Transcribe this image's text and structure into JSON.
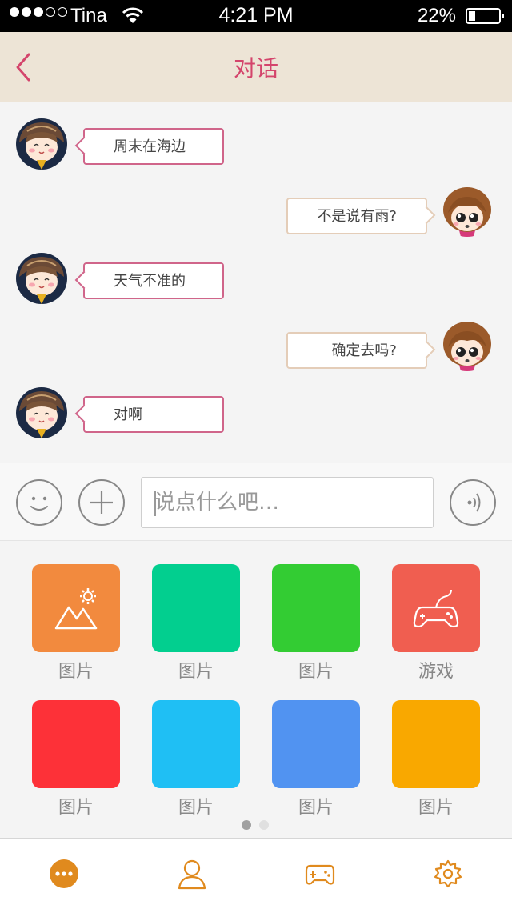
{
  "status": {
    "carrier": "Tina",
    "time": "4:21 PM",
    "battery": "22%",
    "battery_level": 0.22,
    "signal_bars": 3,
    "signal_total": 5
  },
  "nav": {
    "title": "对话",
    "back_icon": "chevron-left-icon"
  },
  "messages": [
    {
      "from": "friend",
      "text": "周末在海边"
    },
    {
      "from": "me",
      "text": "不是说有雨?"
    },
    {
      "from": "friend",
      "text": "天气不准的"
    },
    {
      "from": "me",
      "text": "确定去吗?"
    },
    {
      "from": "friend",
      "text": "对啊"
    }
  ],
  "input": {
    "placeholder": "说点什么吧…",
    "value": ""
  },
  "panel": {
    "items": [
      {
        "label": "图片",
        "color": "#f28a3e",
        "icon": "picture-settings-icon"
      },
      {
        "label": "图片",
        "color": "#02cf8f",
        "icon": ""
      },
      {
        "label": "图片",
        "color": "#33cc33",
        "icon": ""
      },
      {
        "label": "游戏",
        "color": "#f05e50",
        "icon": "gamepad-icon"
      },
      {
        "label": "图片",
        "color": "#fd3138",
        "icon": ""
      },
      {
        "label": "图片",
        "color": "#1fbff4",
        "icon": ""
      },
      {
        "label": "图片",
        "color": "#5193f1",
        "icon": ""
      },
      {
        "label": "图片",
        "color": "#f9a800",
        "icon": ""
      }
    ],
    "page_index": 1,
    "page_count": 2
  },
  "tabs": [
    {
      "icon": "chat-bubble-icon",
      "active": true
    },
    {
      "icon": "person-icon",
      "active": false
    },
    {
      "icon": "gamepad-icon",
      "active": false
    },
    {
      "icon": "gear-icon",
      "active": false
    }
  ],
  "colors": {
    "accent": "#d4456c",
    "tab": "#e08a1e",
    "nav_bg": "#ede4d6"
  }
}
